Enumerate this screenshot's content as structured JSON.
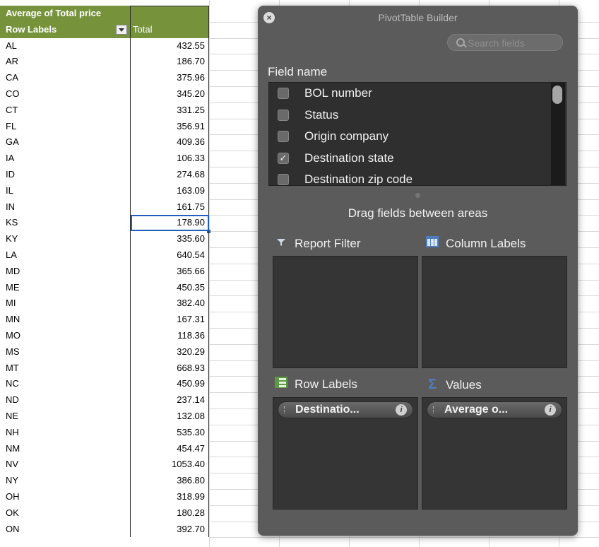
{
  "pivot_table": {
    "header_title": "Average of Total price",
    "row_labels_header": "Row Labels",
    "total_header": "Total",
    "rows": [
      {
        "label": "AL",
        "value": "432.55"
      },
      {
        "label": "AR",
        "value": "186.70"
      },
      {
        "label": "CA",
        "value": "375.96"
      },
      {
        "label": "CO",
        "value": "345.20"
      },
      {
        "label": "CT",
        "value": "331.25"
      },
      {
        "label": "FL",
        "value": "356.91"
      },
      {
        "label": "GA",
        "value": "409.36"
      },
      {
        "label": "IA",
        "value": "106.33"
      },
      {
        "label": "ID",
        "value": "274.68"
      },
      {
        "label": "IL",
        "value": "163.09"
      },
      {
        "label": "IN",
        "value": "161.75"
      },
      {
        "label": "KS",
        "value": "178.90"
      },
      {
        "label": "KY",
        "value": "335.60"
      },
      {
        "label": "LA",
        "value": "640.54"
      },
      {
        "label": "MD",
        "value": "365.66"
      },
      {
        "label": "ME",
        "value": "450.35"
      },
      {
        "label": "MI",
        "value": "382.40"
      },
      {
        "label": "MN",
        "value": "167.31"
      },
      {
        "label": "MO",
        "value": "118.36"
      },
      {
        "label": "MS",
        "value": "320.29"
      },
      {
        "label": "MT",
        "value": "668.93"
      },
      {
        "label": "NC",
        "value": "450.99"
      },
      {
        "label": "ND",
        "value": "237.14"
      },
      {
        "label": "NE",
        "value": "132.08"
      },
      {
        "label": "NH",
        "value": "535.30"
      },
      {
        "label": "NM",
        "value": "454.47"
      },
      {
        "label": "NV",
        "value": "1053.40"
      },
      {
        "label": "NY",
        "value": "386.80"
      },
      {
        "label": "OH",
        "value": "318.99"
      },
      {
        "label": "OK",
        "value": "180.28"
      },
      {
        "label": "ON",
        "value": "392.70"
      }
    ],
    "selected_row": "KS",
    "header_color": "#76933c"
  },
  "builder": {
    "title": "PivotTable Builder",
    "search_placeholder": "Search fields",
    "field_name_label": "Field name",
    "fields": [
      {
        "label": "BOL number",
        "checked": false
      },
      {
        "label": "Status",
        "checked": false
      },
      {
        "label": "Origin company",
        "checked": false
      },
      {
        "label": "Destination state",
        "checked": true
      },
      {
        "label": "Destination zip code",
        "checked": false
      }
    ],
    "drag_hint": "Drag fields between areas",
    "areas": {
      "report_filter": {
        "label": "Report Filter",
        "icon": "funnel-icon"
      },
      "column_labels": {
        "label": "Column Labels",
        "icon": "column-labels-icon"
      },
      "row_labels": {
        "label": "Row Labels",
        "icon": "row-labels-icon",
        "pill": "Destinatio..."
      },
      "values": {
        "label": "Values",
        "icon": "sigma-icon",
        "pill": "Average o..."
      }
    },
    "checkmark": "✓",
    "info_glyph": "i",
    "close_glyph": "×"
  }
}
